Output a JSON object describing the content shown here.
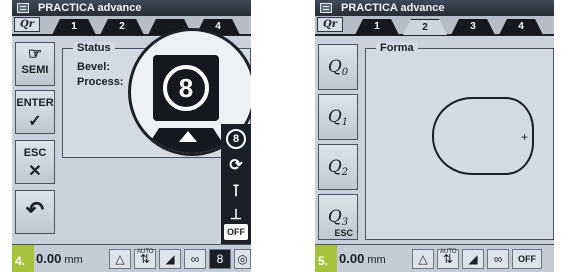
{
  "screens": [
    {
      "figure_label": "4.",
      "window_title": "PRACTICA advance",
      "qr_badge": "Qr",
      "tabs": [
        "1",
        "2",
        "",
        "4"
      ],
      "sidebar": {
        "semi": "SEMI",
        "enter": "ENTER",
        "esc": "ESC"
      },
      "status_panel": {
        "title": "Status",
        "bevel_label": "Bevel:",
        "process_label": "Process:"
      },
      "zoom_value": "8",
      "right_column": {
        "top_value": "8",
        "off_label": "OFF"
      },
      "statusbar": {
        "value": "0.00",
        "unit": "mm",
        "auto_label": "AUTO",
        "active_value": "8"
      }
    },
    {
      "figure_label": "5.",
      "window_title": "PRACTICA advance",
      "qr_badge": "Qr",
      "tabs": [
        "1",
        "2",
        "3",
        "4"
      ],
      "q_buttons": [
        {
          "main": "Q",
          "sub": "0"
        },
        {
          "main": "Q",
          "sub": "1"
        },
        {
          "main": "Q",
          "sub": "2"
        },
        {
          "main": "Q",
          "sub": "3",
          "extra": "ESC"
        }
      ],
      "forma_panel": {
        "title": "Forma",
        "crosshair": "+"
      },
      "statusbar": {
        "value": "0.00",
        "unit": "mm",
        "auto_label": "AUTO",
        "off_label": "OFF"
      }
    }
  ]
}
